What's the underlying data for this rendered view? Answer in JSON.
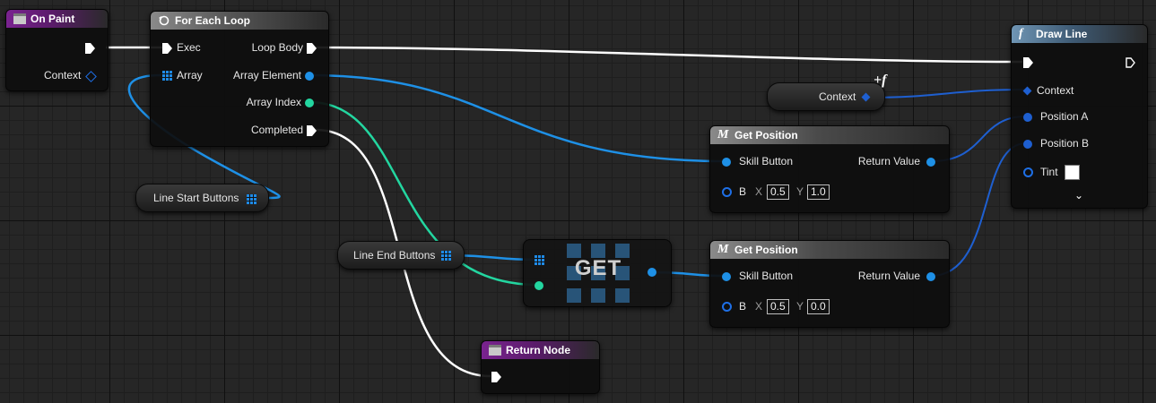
{
  "colors": {
    "exec_wire": "#ffffff",
    "object_wire": "#1e90e6",
    "int_wire": "#23d6a0",
    "struct_wire": "#1e5fd0",
    "event_header": "#7a2390",
    "function_header": "#6f95b4"
  },
  "nodes": {
    "on_paint": {
      "title": "On Paint",
      "icon": "event-icon",
      "context_label": "Context"
    },
    "for_each_loop": {
      "title": "For Each Loop",
      "icon": "loop-macro-icon",
      "exec_label": "Exec",
      "array_label": "Array",
      "loop_body_label": "Loop Body",
      "array_element_label": "Array Element",
      "array_index_label": "Array Index",
      "completed_label": "Completed"
    },
    "line_start_buttons": {
      "label": "Line Start Buttons"
    },
    "line_end_buttons": {
      "label": "Line End Buttons"
    },
    "get_array": {
      "label": "GET"
    },
    "context_var": {
      "label": "Context"
    },
    "get_position_1": {
      "title": "Get Position",
      "icon": "macro-icon",
      "skill_button_label": "Skill Button",
      "return_value_label": "Return Value",
      "b_label": "B",
      "x_axis": "X",
      "x_value": "0.5",
      "y_axis": "Y",
      "y_value": "1.0"
    },
    "get_position_2": {
      "title": "Get Position",
      "icon": "macro-icon",
      "skill_button_label": "Skill Button",
      "return_value_label": "Return Value",
      "b_label": "B",
      "x_axis": "X",
      "x_value": "0.5",
      "y_axis": "Y",
      "y_value": "0.0"
    },
    "draw_line": {
      "title": "Draw Line",
      "icon": "function-icon",
      "context_label": "Context",
      "position_a_label": "Position A",
      "position_b_label": "Position B",
      "tint_label": "Tint",
      "tint_color": "#ffffff",
      "expand_icon": "chevron-down-icon"
    },
    "return_node": {
      "title": "Return Node",
      "icon": "event-icon"
    }
  }
}
